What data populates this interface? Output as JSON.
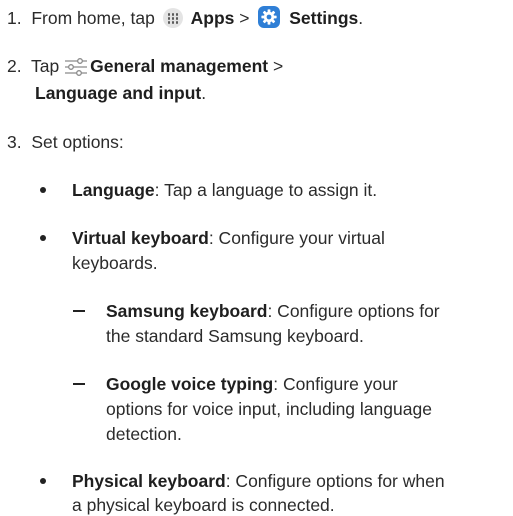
{
  "step1": {
    "number": "1.",
    "prefix": "From home, tap",
    "apps_label": "Apps",
    "separator": ">",
    "settings_label": "Settings",
    "suffix": "."
  },
  "step2": {
    "number": "2.",
    "prefix": "Tap",
    "general_label": "General management",
    "separator": ">",
    "language_label": "Language and input",
    "suffix": "."
  },
  "step3": {
    "number": "3.",
    "text": "Set options:"
  },
  "options": {
    "language": {
      "label": "Language",
      "desc": ": Tap a language to assign it."
    },
    "virtual_keyboard": {
      "label": "Virtual keyboard",
      "desc_line1": ": Configure your virtual",
      "desc_line2": "keyboards."
    },
    "samsung_keyboard": {
      "label": "Samsung keyboard",
      "desc_line1": ": Configure options for",
      "desc_line2": "the standard Samsung keyboard."
    },
    "google_voice": {
      "label": "Google voice typing",
      "desc_line1": ": Configure your",
      "desc_line2": "options for voice input, including language",
      "desc_line3": "detection."
    },
    "physical_keyboard": {
      "label": "Physical keyboard",
      "desc_line1": ": Configure options for when",
      "desc_line2": "a physical keyboard is connected."
    }
  },
  "colors": {
    "text": "#2b2b2b",
    "settings_icon_bg": "#2f7fd6",
    "apps_icon_bg": "#e4e4e4"
  },
  "icons": {
    "apps": "apps-grid-icon",
    "settings": "settings-gear-icon",
    "general_management": "sliders-icon"
  }
}
